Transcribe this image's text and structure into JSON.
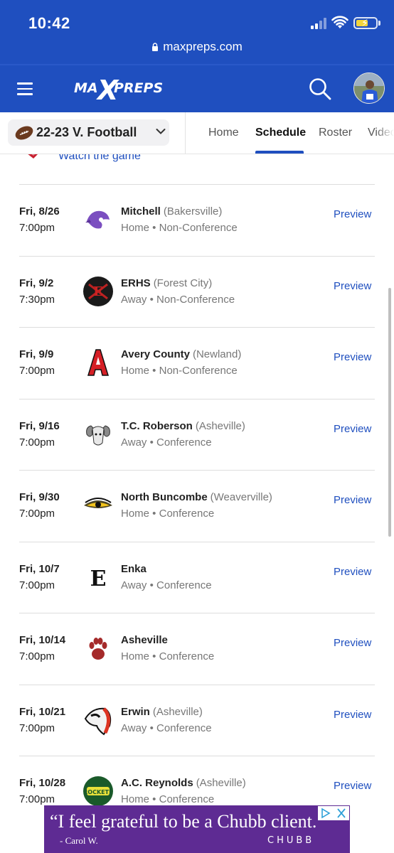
{
  "status_bar": {
    "time": "10:42"
  },
  "browser": {
    "url": "maxpreps.com"
  },
  "header": {
    "logo_text": "MAXPREPS"
  },
  "team_selector": {
    "label": "22-23 V. Football"
  },
  "tabs": [
    {
      "label": "Home",
      "active": false
    },
    {
      "label": "Schedule",
      "active": true
    },
    {
      "label": "Roster",
      "active": false
    },
    {
      "label": "Videos",
      "active": false
    }
  ],
  "watch": {
    "label": "Watch the game"
  },
  "games": [
    {
      "date": "Fri, 8/26",
      "time": "7:00pm",
      "opponent": "Mitchell",
      "city": "(Bakersville)",
      "location": "Home",
      "type": "Non-Conference",
      "action": "Preview",
      "logo_icon": "mountaineer-logo-icon"
    },
    {
      "date": "Fri, 9/2",
      "time": "7:30pm",
      "opponent": "ERHS",
      "city": "(Forest City)",
      "location": "Away",
      "type": "Non-Conference",
      "action": "Preview",
      "logo_icon": "erhs-logo-icon"
    },
    {
      "date": "Fri, 9/9",
      "time": "7:00pm",
      "opponent": "Avery County",
      "city": "(Newland)",
      "location": "Home",
      "type": "Non-Conference",
      "action": "Preview",
      "logo_icon": "letter-a-logo-icon"
    },
    {
      "date": "Fri, 9/16",
      "time": "7:00pm",
      "opponent": "T.C. Roberson",
      "city": "(Asheville)",
      "location": "Away",
      "type": "Conference",
      "action": "Preview",
      "logo_icon": "ram-logo-icon"
    },
    {
      "date": "Fri, 9/30",
      "time": "7:00pm",
      "opponent": "North Buncombe",
      "city": "(Weaverville)",
      "location": "Home",
      "type": "Conference",
      "action": "Preview",
      "logo_icon": "hawkeye-logo-icon"
    },
    {
      "date": "Fri, 10/7",
      "time": "7:00pm",
      "opponent": "Enka",
      "city": "",
      "location": "Away",
      "type": "Conference",
      "action": "Preview",
      "logo_icon": "letter-e-logo-icon"
    },
    {
      "date": "Fri, 10/14",
      "time": "7:00pm",
      "opponent": "Asheville",
      "city": "",
      "location": "Home",
      "type": "Conference",
      "action": "Preview",
      "logo_icon": "paw-logo-icon"
    },
    {
      "date": "Fri, 10/21",
      "time": "7:00pm",
      "opponent": "Erwin",
      "city": "(Asheville)",
      "location": "Away",
      "type": "Conference",
      "action": "Preview",
      "logo_icon": "warrior-logo-icon"
    },
    {
      "date": "Fri, 10/28",
      "time": "7:00pm",
      "opponent": "A.C. Reynolds",
      "city": "(Asheville)",
      "location": "Home",
      "type": "Conference",
      "action": "Preview",
      "logo_icon": "rockets-logo-icon"
    }
  ],
  "ad": {
    "quote": "“I feel grateful to be a Chubb client.",
    "author": "- Carol W.",
    "brand": "CHUBB"
  },
  "colors": {
    "brand_blue": "#1f4fbf",
    "ad_purple": "#5e2b93"
  }
}
